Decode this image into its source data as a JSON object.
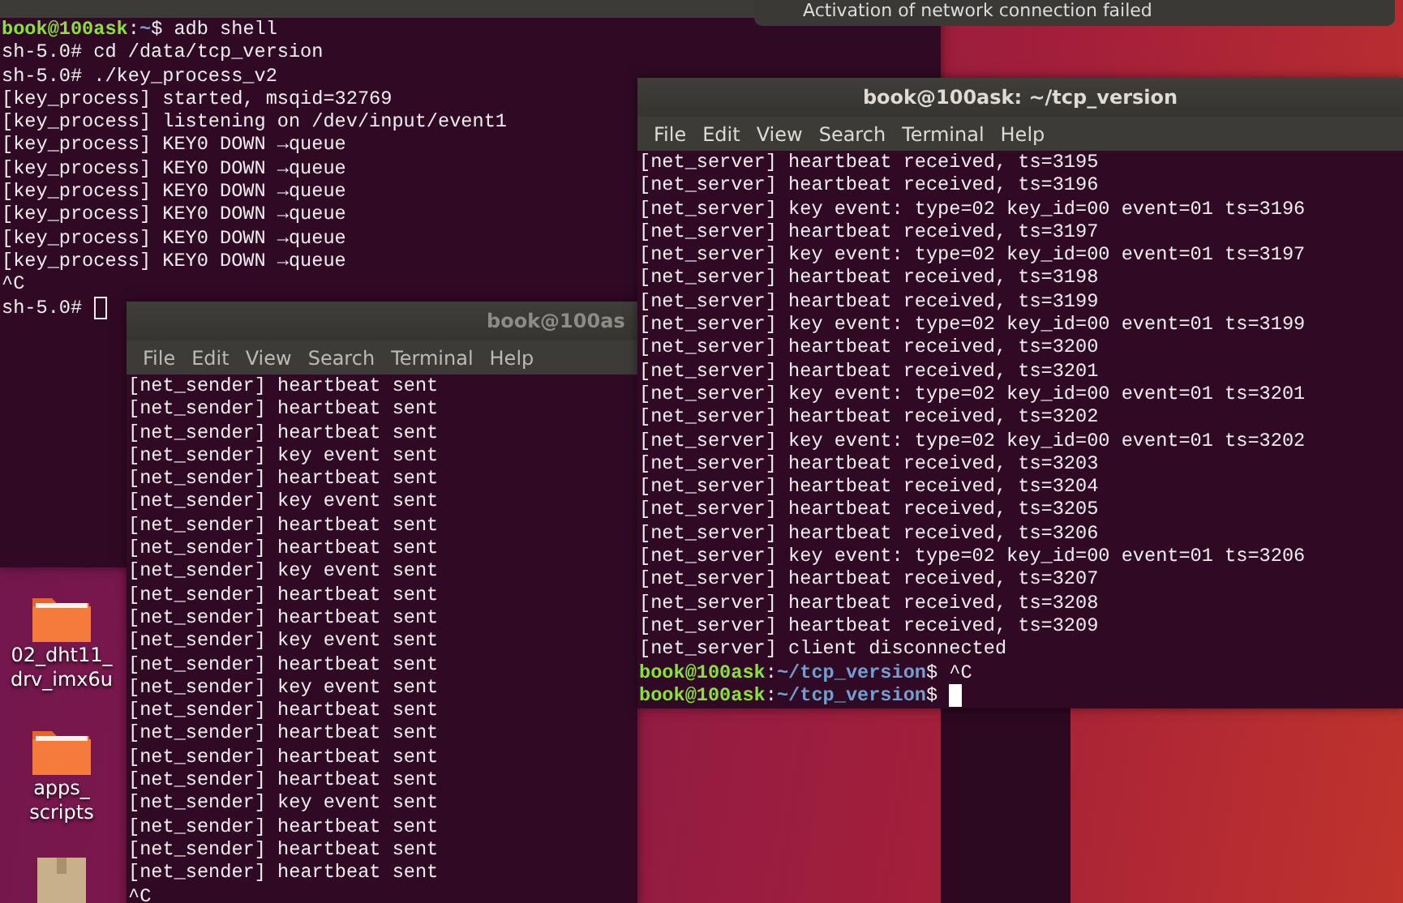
{
  "notification": {
    "text": "Activation of network connection failed"
  },
  "desktop_icons": [
    {
      "kind": "folder",
      "label_lines": [
        "02_dht11_",
        "drv_imx6u"
      ]
    },
    {
      "kind": "folder",
      "label_lines": [
        "apps_",
        "scripts"
      ]
    },
    {
      "kind": "package"
    }
  ],
  "terminals": [
    {
      "focused": false,
      "cursor_shown": true,
      "lines": [
        {
          "kind": "prompt",
          "user": "book@100ask",
          "separator": ":",
          "path": "~",
          "command": "$ adb shell"
        },
        {
          "kind": "output",
          "text": "sh-5.0# cd /data/tcp_version"
        },
        {
          "kind": "output",
          "text": "sh-5.0# ./key_process_v2"
        },
        {
          "kind": "output",
          "text": "[key_process] started, msqid=32769"
        },
        {
          "kind": "output",
          "text": "[key_process] listening on /dev/input/event1"
        },
        {
          "kind": "output",
          "text": "[key_process] KEY0 DOWN →queue"
        },
        {
          "kind": "output",
          "text": "[key_process] KEY0 DOWN →queue"
        },
        {
          "kind": "output",
          "text": "[key_process] KEY0 DOWN →queue"
        },
        {
          "kind": "output",
          "text": "[key_process] KEY0 DOWN →queue"
        },
        {
          "kind": "output",
          "text": "[key_process] KEY0 DOWN →queue"
        },
        {
          "kind": "output",
          "text": "[key_process] KEY0 DOWN →queue"
        },
        {
          "kind": "output",
          "text": "^C"
        },
        {
          "kind": "output",
          "text": "sh-5.0# "
        }
      ]
    },
    {
      "title": "book@100as",
      "focused": false,
      "cursor_shown": false,
      "menu": [
        "File",
        "Edit",
        "View",
        "Search",
        "Terminal",
        "Help"
      ],
      "lines": [
        {
          "kind": "output",
          "text": "[net_sender] heartbeat sent"
        },
        {
          "kind": "output",
          "text": "[net_sender] heartbeat sent"
        },
        {
          "kind": "output",
          "text": "[net_sender] heartbeat sent"
        },
        {
          "kind": "output",
          "text": "[net_sender] key event sent"
        },
        {
          "kind": "output",
          "text": "[net_sender] heartbeat sent"
        },
        {
          "kind": "output",
          "text": "[net_sender] key event sent"
        },
        {
          "kind": "output",
          "text": "[net_sender] heartbeat sent"
        },
        {
          "kind": "output",
          "text": "[net_sender] heartbeat sent"
        },
        {
          "kind": "output",
          "text": "[net_sender] key event sent"
        },
        {
          "kind": "output",
          "text": "[net_sender] heartbeat sent"
        },
        {
          "kind": "output",
          "text": "[net_sender] heartbeat sent"
        },
        {
          "kind": "output",
          "text": "[net_sender] key event sent"
        },
        {
          "kind": "output",
          "text": "[net_sender] heartbeat sent"
        },
        {
          "kind": "output",
          "text": "[net_sender] key event sent"
        },
        {
          "kind": "output",
          "text": "[net_sender] heartbeat sent"
        },
        {
          "kind": "output",
          "text": "[net_sender] heartbeat sent"
        },
        {
          "kind": "output",
          "text": "[net_sender] heartbeat sent"
        },
        {
          "kind": "output",
          "text": "[net_sender] heartbeat sent"
        },
        {
          "kind": "output",
          "text": "[net_sender] key event sent"
        },
        {
          "kind": "output",
          "text": "[net_sender] heartbeat sent"
        },
        {
          "kind": "output",
          "text": "[net_sender] heartbeat sent"
        },
        {
          "kind": "output",
          "text": "[net_sender] heartbeat sent"
        },
        {
          "kind": "output",
          "text": "^C"
        }
      ]
    },
    {
      "title": "book@100ask: ~/tcp_version",
      "focused": true,
      "cursor_shown": true,
      "menu": [
        "File",
        "Edit",
        "View",
        "Search",
        "Terminal",
        "Help"
      ],
      "lines": [
        {
          "kind": "output",
          "text": "[net_server] heartbeat received, ts=3195"
        },
        {
          "kind": "output",
          "text": "[net_server] heartbeat received, ts=3196"
        },
        {
          "kind": "output",
          "text": "[net_server] key event: type=02 key_id=00 event=01 ts=3196"
        },
        {
          "kind": "output",
          "text": "[net_server] heartbeat received, ts=3197"
        },
        {
          "kind": "output",
          "text": "[net_server] key event: type=02 key_id=00 event=01 ts=3197"
        },
        {
          "kind": "output",
          "text": "[net_server] heartbeat received, ts=3198"
        },
        {
          "kind": "output",
          "text": "[net_server] heartbeat received, ts=3199"
        },
        {
          "kind": "output",
          "text": "[net_server] key event: type=02 key_id=00 event=01 ts=3199"
        },
        {
          "kind": "output",
          "text": "[net_server] heartbeat received, ts=3200"
        },
        {
          "kind": "output",
          "text": "[net_server] heartbeat received, ts=3201"
        },
        {
          "kind": "output",
          "text": "[net_server] key event: type=02 key_id=00 event=01 ts=3201"
        },
        {
          "kind": "output",
          "text": "[net_server] heartbeat received, ts=3202"
        },
        {
          "kind": "output",
          "text": "[net_server] key event: type=02 key_id=00 event=01 ts=3202"
        },
        {
          "kind": "output",
          "text": "[net_server] heartbeat received, ts=3203"
        },
        {
          "kind": "output",
          "text": "[net_server] heartbeat received, ts=3204"
        },
        {
          "kind": "output",
          "text": "[net_server] heartbeat received, ts=3205"
        },
        {
          "kind": "output",
          "text": "[net_server] heartbeat received, ts=3206"
        },
        {
          "kind": "output",
          "text": "[net_server] key event: type=02 key_id=00 event=01 ts=3206"
        },
        {
          "kind": "output",
          "text": "[net_server] heartbeat received, ts=3207"
        },
        {
          "kind": "output",
          "text": "[net_server] heartbeat received, ts=3208"
        },
        {
          "kind": "output",
          "text": "[net_server] heartbeat received, ts=3209"
        },
        {
          "kind": "output",
          "text": "[net_server] client disconnected"
        },
        {
          "kind": "prompt",
          "user": "book@100ask",
          "separator": ":",
          "path": "~/tcp_version",
          "command": "$ ^C"
        },
        {
          "kind": "prompt",
          "user": "book@100ask",
          "separator": ":",
          "path": "~/tcp_version",
          "command": "$ "
        }
      ]
    }
  ]
}
